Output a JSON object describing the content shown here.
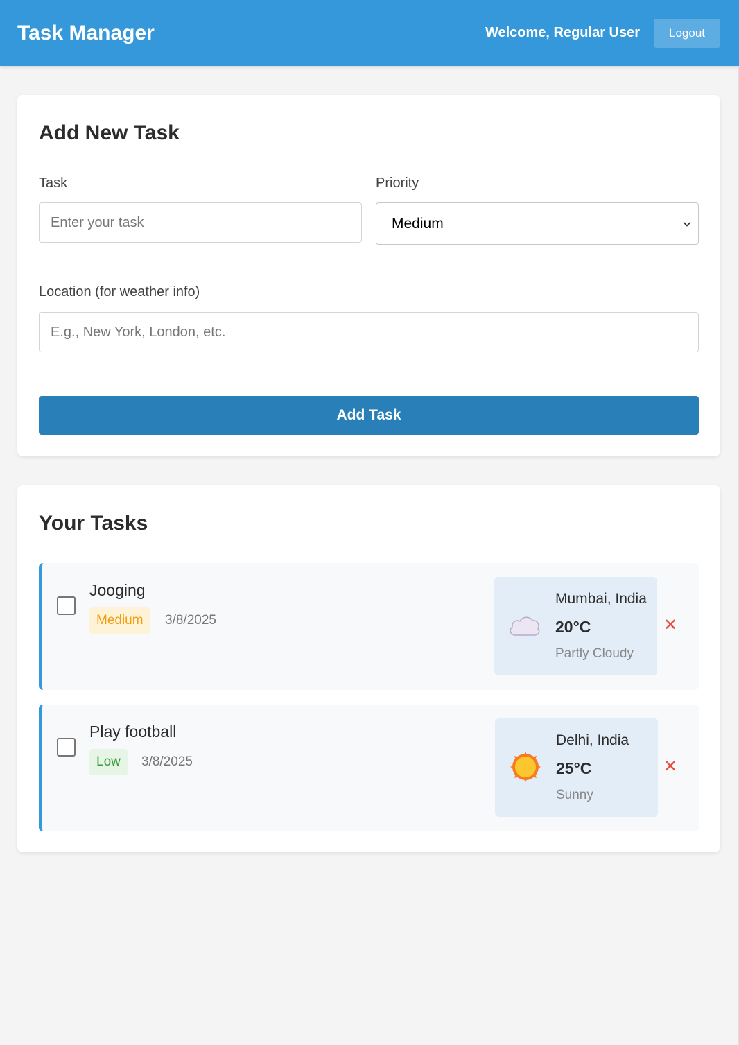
{
  "header": {
    "title": "Task Manager",
    "welcome": "Welcome, Regular User",
    "logout_label": "Logout"
  },
  "add_task": {
    "heading": "Add New Task",
    "task_label": "Task",
    "task_placeholder": "Enter your task",
    "priority_label": "Priority",
    "priority_selected": "Medium",
    "location_label": "Location (for weather info)",
    "location_placeholder": "E.g., New York, London, etc.",
    "submit_label": "Add Task"
  },
  "tasks": {
    "heading": "Your Tasks",
    "items": [
      {
        "title": "Jooging",
        "priority": "Medium",
        "date": "3/8/2025",
        "weather": {
          "location": "Mumbai, India",
          "temp": "20°C",
          "condition": "Partly Cloudy",
          "icon": "cloud-icon"
        },
        "delete_label": "✕"
      },
      {
        "title": "Play football",
        "priority": "Low",
        "date": "3/8/2025",
        "weather": {
          "location": "Delhi, India",
          "temp": "25°C",
          "condition": "Sunny",
          "icon": "sun-icon"
        },
        "delete_label": "✕"
      }
    ]
  },
  "colors": {
    "header": "#3498db",
    "primary_button": "#2980b9",
    "delete": "#e74c3c",
    "badge_medium": "#f39c12",
    "badge_low": "#3a9b3a"
  }
}
